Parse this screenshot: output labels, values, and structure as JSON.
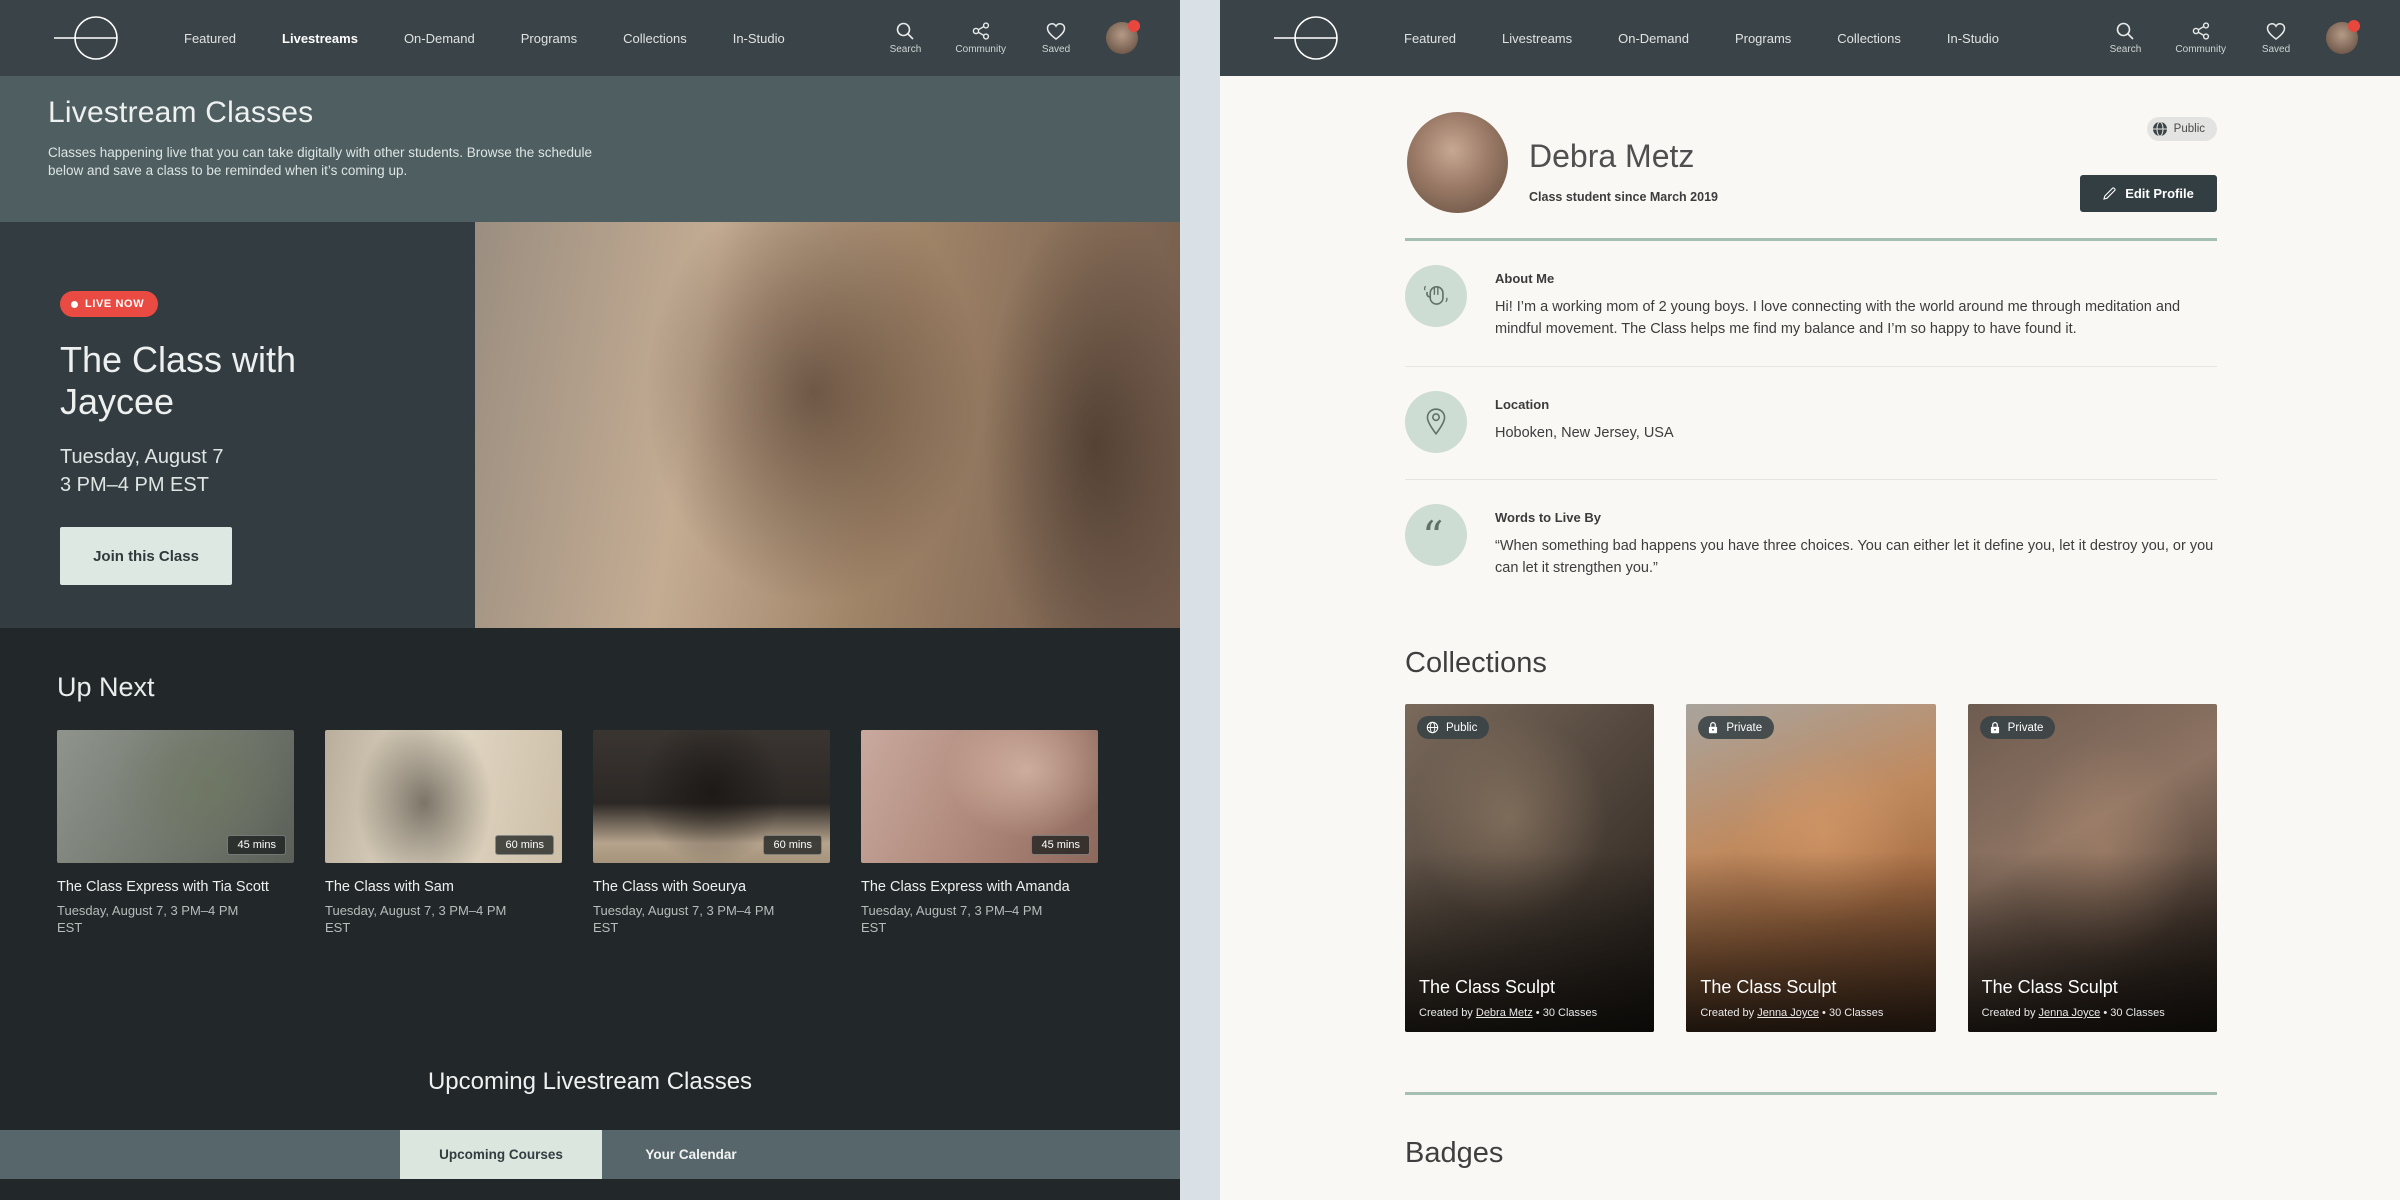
{
  "colors": {
    "nav_bg": "#3a4347",
    "page_header_bg": "#4e5e61",
    "hero_bg": "#333d41",
    "dark_section_bg": "#22282a",
    "live_badge_red": "#e94a41",
    "tab_bar_bg": "#57666a",
    "tab_active_bg": "#dbe6df",
    "cta_bg": "#dee8e2",
    "right_body_bg": "#faf8f5",
    "sage_accent": "#a5c0b3",
    "icon_circle_bg": "#cdddd3",
    "panel_seam": "#d9e1e6"
  },
  "icons": {
    "quote_glyph": "“"
  },
  "nav": {
    "items": [
      "Featured",
      "Livestreams",
      "On-Demand",
      "Programs",
      "Collections",
      "In-Studio"
    ],
    "active_item_left": "Livestreams",
    "actions": [
      "Search",
      "Community",
      "Saved"
    ]
  },
  "left": {
    "header": {
      "title": "Livestream Classes",
      "subtitle": "Classes happening live that you can take digitally with other students. Browse the schedule below and save a class to be reminded when it’s coming up."
    },
    "hero": {
      "live_badge": "LIVE NOW",
      "title": "The Class with Jaycee",
      "date": "Tuesday, August 7",
      "time": "3 PM–4 PM EST",
      "cta": "Join this Class"
    },
    "up_next": {
      "heading": "Up Next",
      "cards": [
        {
          "title": "The Class Express with Tia Scott",
          "duration": "45 mins",
          "schedule": "Tuesday, August 7, 3 PM–4 PM EST"
        },
        {
          "title": "The Class with Sam",
          "duration": "60 mins",
          "schedule": "Tuesday, August 7, 3 PM–4 PM EST"
        },
        {
          "title": "The Class with Soeurya",
          "duration": "60 mins",
          "schedule": "Tuesday, August 7, 3 PM–4 PM EST"
        },
        {
          "title": "The Class Express with Amanda",
          "duration": "45 mins",
          "schedule": "Tuesday, August 7, 3 PM–4 PM EST"
        }
      ]
    },
    "upcoming": {
      "heading": "Upcoming Livestream Classes",
      "tabs": [
        "Upcoming Courses",
        "Your Calendar"
      ],
      "active_tab": "Upcoming Courses"
    }
  },
  "right": {
    "profile": {
      "name": "Debra Metz",
      "membership": "Class student since March 2019",
      "visibility_badge": "Public",
      "edit_button": "Edit Profile"
    },
    "about": {
      "label": "About Me",
      "text": "Hi! I’m a working mom of 2 young boys. I love connecting with the world around me through meditation and mindful movement. The Class helps me find my balance and I’m so happy to have found it."
    },
    "location": {
      "label": "Location",
      "text": "Hoboken, New Jersey, USA"
    },
    "words": {
      "label": "Words to Live By",
      "text": "“When something bad happens you have three choices. You can either let it define you, let it destroy you, or you can let it strengthen you.”"
    },
    "collections": {
      "heading": "Collections",
      "created_by_label": "Created by",
      "separator": "•",
      "cards": [
        {
          "visibility": "Public",
          "title": "The Class Sculpt",
          "creator": "Debra Metz",
          "meta": "30 Classes"
        },
        {
          "visibility": "Private",
          "title": "The Class Sculpt",
          "creator": "Jenna Joyce",
          "meta": "30 Classes"
        },
        {
          "visibility": "Private",
          "title": "The Class Sculpt",
          "creator": "Jenna Joyce",
          "meta": "30 Classes"
        }
      ]
    },
    "badges": {
      "heading": "Badges"
    }
  }
}
